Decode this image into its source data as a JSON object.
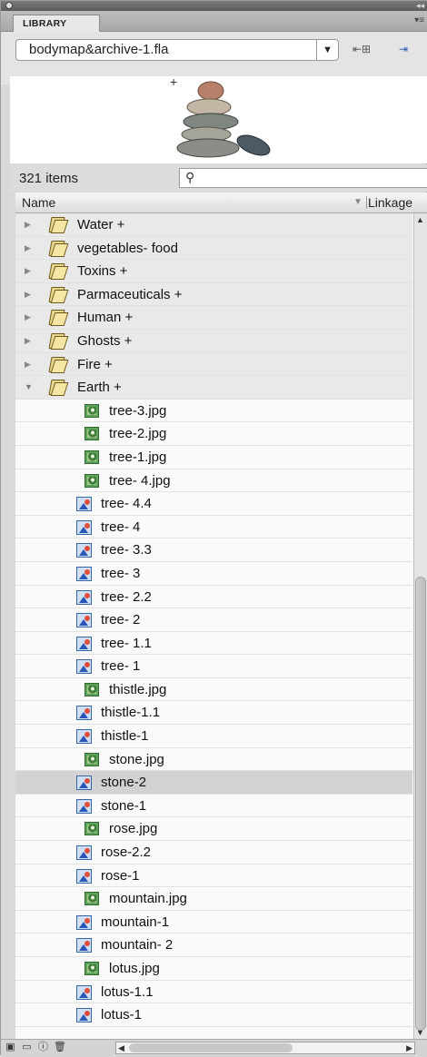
{
  "panel": {
    "tab_label": "LIBRARY",
    "document_name": "bodymap&archive-1.fla",
    "item_count": "321 items",
    "search_placeholder": "",
    "column_name": "Name",
    "column_linkage": "Linkage"
  },
  "icons": {
    "folder": "folder-icon",
    "bitmap": "bitmap-icon",
    "graphic": "graphic-symbol-icon"
  },
  "folders": [
    {
      "label": "Water +"
    },
    {
      "label": "vegetables- food"
    },
    {
      "label": "Toxins +"
    },
    {
      "label": "Parmaceuticals +"
    },
    {
      "label": "Human +"
    },
    {
      "label": "Ghosts +"
    },
    {
      "label": "Fire +"
    },
    {
      "label": "Earth +"
    }
  ],
  "earth_items": [
    {
      "label": "tree-3.jpg",
      "type": "bitmap"
    },
    {
      "label": "tree-2.jpg",
      "type": "bitmap"
    },
    {
      "label": "tree-1.jpg",
      "type": "bitmap"
    },
    {
      "label": "tree- 4.jpg",
      "type": "bitmap"
    },
    {
      "label": "tree- 4.4",
      "type": "graphic"
    },
    {
      "label": "tree- 4",
      "type": "graphic"
    },
    {
      "label": "tree- 3.3",
      "type": "graphic"
    },
    {
      "label": "tree- 3",
      "type": "graphic"
    },
    {
      "label": "tree- 2.2",
      "type": "graphic"
    },
    {
      "label": "tree- 2",
      "type": "graphic"
    },
    {
      "label": "tree- 1.1",
      "type": "graphic"
    },
    {
      "label": "tree- 1",
      "type": "graphic"
    },
    {
      "label": "thistle.jpg",
      "type": "bitmap"
    },
    {
      "label": "thistle-1.1",
      "type": "graphic"
    },
    {
      "label": "thistle-1",
      "type": "graphic"
    },
    {
      "label": "stone.jpg",
      "type": "bitmap"
    },
    {
      "label": "stone-2",
      "type": "graphic",
      "selected": true
    },
    {
      "label": "stone-1",
      "type": "graphic"
    },
    {
      "label": "rose.jpg",
      "type": "bitmap"
    },
    {
      "label": "rose-2.2",
      "type": "graphic"
    },
    {
      "label": "rose-1",
      "type": "graphic"
    },
    {
      "label": "mountain.jpg",
      "type": "bitmap"
    },
    {
      "label": "mountain-1",
      "type": "graphic"
    },
    {
      "label": "mountain- 2",
      "type": "graphic"
    },
    {
      "label": "lotus.jpg",
      "type": "bitmap"
    },
    {
      "label": "lotus-1.1",
      "type": "graphic"
    },
    {
      "label": "lotus-1",
      "type": "graphic"
    }
  ]
}
